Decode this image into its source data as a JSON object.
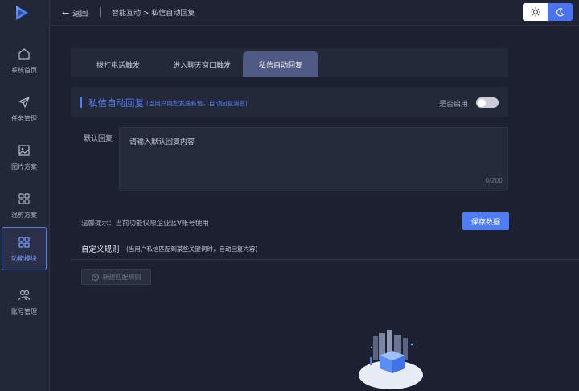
{
  "topbar": {
    "back_label": "返回",
    "breadcrumb": "智能互动 > 私信自动回复",
    "theme_light_icon": "sun-icon",
    "theme_dark_icon": "moon-icon"
  },
  "sidebar": {
    "logo_icon": "play-logo-icon",
    "items": [
      {
        "label": "系统首页",
        "icon": "home-icon",
        "active": false
      },
      {
        "label": "任务管理",
        "icon": "paper-plane-icon",
        "active": false
      },
      {
        "label": "图片方案",
        "icon": "image-icon",
        "active": false
      },
      {
        "label": "混剪方案",
        "icon": "grid-icon",
        "active": false
      },
      {
        "label": "功能模块",
        "icon": "modules-icon",
        "active": true
      },
      {
        "label": "账号管理",
        "icon": "users-icon",
        "active": false
      }
    ]
  },
  "tabs": [
    {
      "label": "拨打电话触发",
      "active": false
    },
    {
      "label": "进入聊天窗口触发",
      "active": false
    },
    {
      "label": "私信自动回复",
      "active": true
    }
  ],
  "panel": {
    "title": "私信自动回复",
    "subtitle": "(当用户向您发送私信，自动回复消息)",
    "enable_label": "是否启用",
    "enabled": false
  },
  "default_reply": {
    "label": "默认回复",
    "placeholder": "请输入默认回复内容",
    "counter": "0/200"
  },
  "tip": "温馨提示：当前功能仅限企业蓝V账号使用",
  "save_label": "保存数据",
  "custom_rules": {
    "title": "自定义规则",
    "subtitle": "(当用户私信匹配到某些关键词时，自动回复内容)",
    "new_rule_label": "新建匹配规则"
  },
  "colors": {
    "accent": "#4f7df3",
    "background": "#1c2030",
    "sidebar": "#232838"
  }
}
